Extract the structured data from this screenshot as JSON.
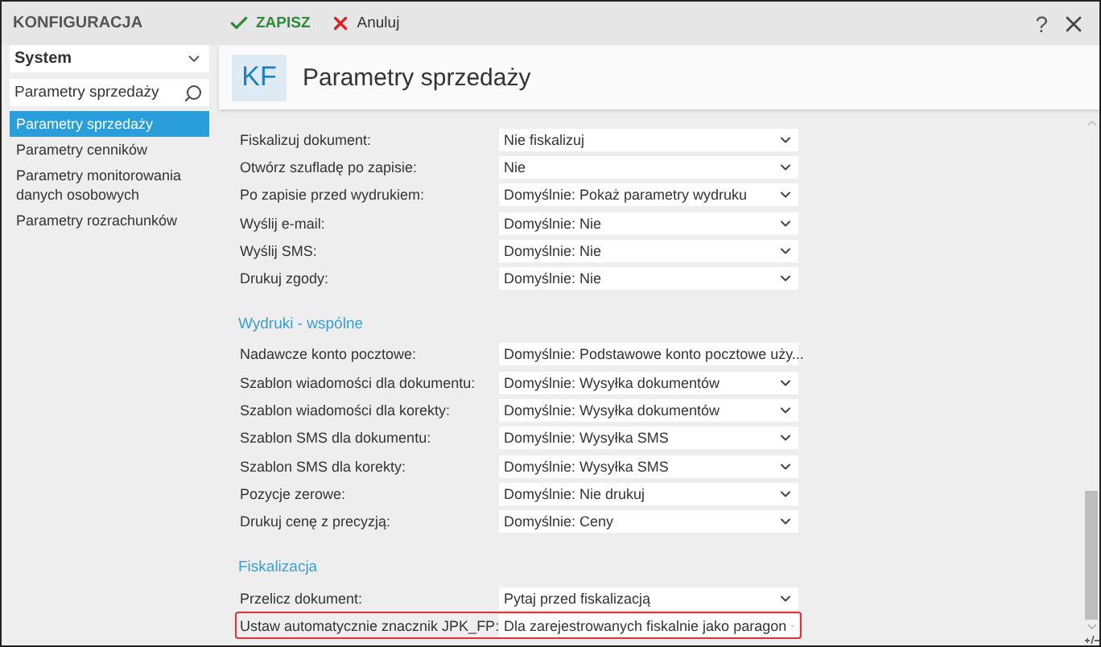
{
  "window": {
    "title": "KONFIGURACJA",
    "help": "?"
  },
  "toolbar": {
    "buttons": [
      {
        "kind": "save",
        "label": "ZAPISZ"
      },
      {
        "kind": "cancel",
        "label": "Anuluj"
      }
    ]
  },
  "sidebar": {
    "dropdown": "System",
    "search": {
      "value": "Parametry sprzedaży"
    },
    "items": [
      {
        "label": "Parametry sprzedaży",
        "selected": true
      },
      {
        "label": "Parametry cenników",
        "selected": false
      },
      {
        "label": "Parametry monitorowania danych osobowych",
        "selected": false
      },
      {
        "label": "Parametry rozrachunków",
        "selected": false
      }
    ]
  },
  "header": {
    "badge": "KF",
    "title": "Parametry sprzedaży"
  },
  "sections": [
    {
      "rows": [
        {
          "label": "Fiskalizuj dokument:",
          "value": "Nie fiskalizuj",
          "highlighted": false
        },
        {
          "label": "Otwórz szufladę po zapisie:",
          "value": "Nie",
          "highlighted": false
        },
        {
          "label": "Po zapisie przed wydrukiem:",
          "value": "Domyślnie: Pokaż parametry wydruku",
          "highlighted": false
        },
        {
          "label": "Wyślij e-mail:",
          "value": "Domyślnie: Nie",
          "highlighted": false
        },
        {
          "label": "Wyślij SMS:",
          "value": "Domyślnie: Nie",
          "highlighted": false
        },
        {
          "label": "Drukuj zgody:",
          "value": "Domyślnie: Nie",
          "highlighted": false
        }
      ]
    },
    {
      "title": "Wydruki - wspólne",
      "rows": [
        {
          "label": "Nadawcze konto pocztowe:",
          "value": "Domyślnie: Podstawowe konto pocztowe uży...",
          "highlighted": false
        },
        {
          "label": "Szablon wiadomości dla dokumentu:",
          "value": "Domyślnie: Wysyłka dokumentów",
          "highlighted": false
        },
        {
          "label": "Szablon wiadomości dla korekty:",
          "value": "Domyślnie: Wysyłka dokumentów",
          "highlighted": false
        },
        {
          "label": "Szablon SMS dla dokumentu:",
          "value": "Domyślnie: Wysyłka SMS",
          "highlighted": false
        },
        {
          "label": "Szablon SMS dla korekty:",
          "value": "Domyślnie: Wysyłka SMS",
          "highlighted": false
        },
        {
          "label": "Pozycje zerowe:",
          "value": "Domyślnie: Nie drukuj",
          "highlighted": false
        },
        {
          "label": "Drukuj cenę z precyzją:",
          "value": "Domyślnie: Ceny",
          "highlighted": false
        }
      ]
    },
    {
      "title": "Fiskalizacja",
      "rows": [
        {
          "label": "Przelicz dokument:",
          "value": "Pytaj przed fiskalizacją",
          "highlighted": false
        },
        {
          "label": "Ustaw automatycznie znacznik JPK_FP:",
          "value": "Dla zarejestrowanych fiskalnie jako paragon",
          "highlighted": true
        }
      ]
    }
  ]
}
